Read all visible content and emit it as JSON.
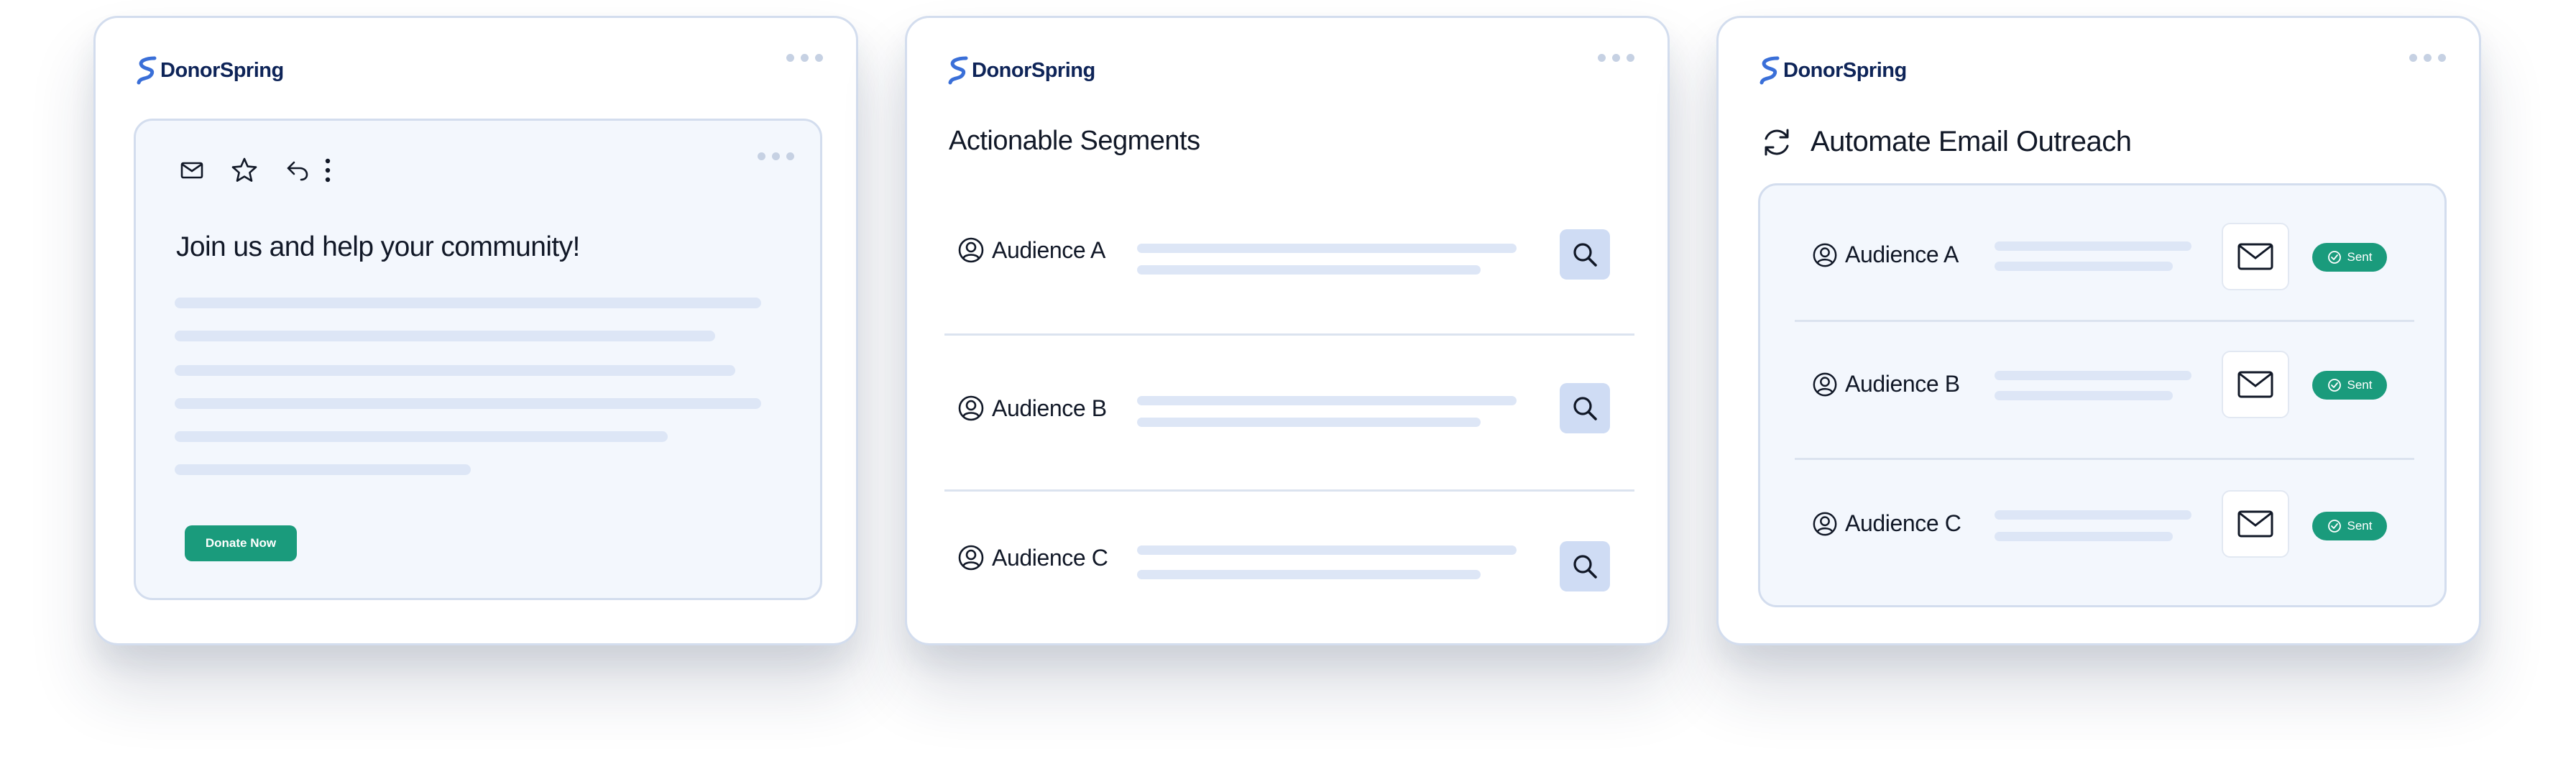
{
  "brand": {
    "name": "DonorSpring",
    "logo_color": "#3a6fd8",
    "text_color": "#0e2458"
  },
  "colors": {
    "accent_green": "#1a9b7c",
    "panel_bg": "#f3f7fd",
    "placeholder_bar": "#dde6f6",
    "search_bg": "#cfdcf4"
  },
  "email_card": {
    "toolbar_icons": [
      "mail-icon",
      "star-icon",
      "reply-icon",
      "more-vertical-icon"
    ],
    "title": "Join us and help your community!",
    "button_label": "Donate Now"
  },
  "segments_card": {
    "title": "Actionable Segments",
    "audiences": [
      {
        "label": "Audience A",
        "icon": "user-circle-icon",
        "action_icon": "search-icon"
      },
      {
        "label": "Audience B",
        "icon": "user-circle-icon",
        "action_icon": "search-icon"
      },
      {
        "label": "Audience C",
        "icon": "user-circle-icon",
        "action_icon": "search-icon"
      }
    ]
  },
  "outreach_card": {
    "title": "Automate Email Outreach",
    "title_icon": "refresh-icon",
    "audiences": [
      {
        "label": "Audience A",
        "status": "Sent"
      },
      {
        "label": "Audience B",
        "status": "Sent"
      },
      {
        "label": "Audience C",
        "status": "Sent"
      }
    ]
  }
}
